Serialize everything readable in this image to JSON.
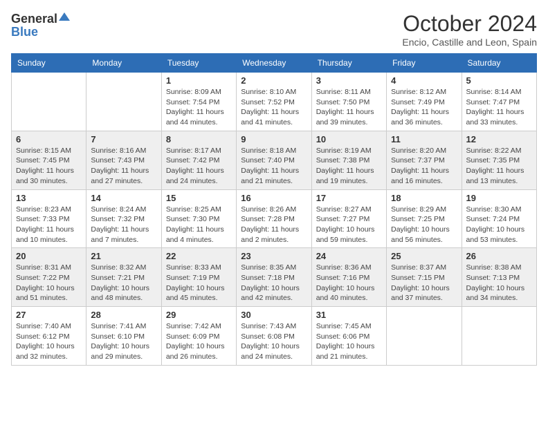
{
  "header": {
    "logo_general": "General",
    "logo_blue": "Blue",
    "month_title": "October 2024",
    "subtitle": "Encio, Castille and Leon, Spain"
  },
  "weekdays": [
    "Sunday",
    "Monday",
    "Tuesday",
    "Wednesday",
    "Thursday",
    "Friday",
    "Saturday"
  ],
  "weeks": [
    [
      {
        "day": "",
        "info": ""
      },
      {
        "day": "",
        "info": ""
      },
      {
        "day": "1",
        "info": "Sunrise: 8:09 AM\nSunset: 7:54 PM\nDaylight: 11 hours and 44 minutes."
      },
      {
        "day": "2",
        "info": "Sunrise: 8:10 AM\nSunset: 7:52 PM\nDaylight: 11 hours and 41 minutes."
      },
      {
        "day": "3",
        "info": "Sunrise: 8:11 AM\nSunset: 7:50 PM\nDaylight: 11 hours and 39 minutes."
      },
      {
        "day": "4",
        "info": "Sunrise: 8:12 AM\nSunset: 7:49 PM\nDaylight: 11 hours and 36 minutes."
      },
      {
        "day": "5",
        "info": "Sunrise: 8:14 AM\nSunset: 7:47 PM\nDaylight: 11 hours and 33 minutes."
      }
    ],
    [
      {
        "day": "6",
        "info": "Sunrise: 8:15 AM\nSunset: 7:45 PM\nDaylight: 11 hours and 30 minutes."
      },
      {
        "day": "7",
        "info": "Sunrise: 8:16 AM\nSunset: 7:43 PM\nDaylight: 11 hours and 27 minutes."
      },
      {
        "day": "8",
        "info": "Sunrise: 8:17 AM\nSunset: 7:42 PM\nDaylight: 11 hours and 24 minutes."
      },
      {
        "day": "9",
        "info": "Sunrise: 8:18 AM\nSunset: 7:40 PM\nDaylight: 11 hours and 21 minutes."
      },
      {
        "day": "10",
        "info": "Sunrise: 8:19 AM\nSunset: 7:38 PM\nDaylight: 11 hours and 19 minutes."
      },
      {
        "day": "11",
        "info": "Sunrise: 8:20 AM\nSunset: 7:37 PM\nDaylight: 11 hours and 16 minutes."
      },
      {
        "day": "12",
        "info": "Sunrise: 8:22 AM\nSunset: 7:35 PM\nDaylight: 11 hours and 13 minutes."
      }
    ],
    [
      {
        "day": "13",
        "info": "Sunrise: 8:23 AM\nSunset: 7:33 PM\nDaylight: 11 hours and 10 minutes."
      },
      {
        "day": "14",
        "info": "Sunrise: 8:24 AM\nSunset: 7:32 PM\nDaylight: 11 hours and 7 minutes."
      },
      {
        "day": "15",
        "info": "Sunrise: 8:25 AM\nSunset: 7:30 PM\nDaylight: 11 hours and 4 minutes."
      },
      {
        "day": "16",
        "info": "Sunrise: 8:26 AM\nSunset: 7:28 PM\nDaylight: 11 hours and 2 minutes."
      },
      {
        "day": "17",
        "info": "Sunrise: 8:27 AM\nSunset: 7:27 PM\nDaylight: 10 hours and 59 minutes."
      },
      {
        "day": "18",
        "info": "Sunrise: 8:29 AM\nSunset: 7:25 PM\nDaylight: 10 hours and 56 minutes."
      },
      {
        "day": "19",
        "info": "Sunrise: 8:30 AM\nSunset: 7:24 PM\nDaylight: 10 hours and 53 minutes."
      }
    ],
    [
      {
        "day": "20",
        "info": "Sunrise: 8:31 AM\nSunset: 7:22 PM\nDaylight: 10 hours and 51 minutes."
      },
      {
        "day": "21",
        "info": "Sunrise: 8:32 AM\nSunset: 7:21 PM\nDaylight: 10 hours and 48 minutes."
      },
      {
        "day": "22",
        "info": "Sunrise: 8:33 AM\nSunset: 7:19 PM\nDaylight: 10 hours and 45 minutes."
      },
      {
        "day": "23",
        "info": "Sunrise: 8:35 AM\nSunset: 7:18 PM\nDaylight: 10 hours and 42 minutes."
      },
      {
        "day": "24",
        "info": "Sunrise: 8:36 AM\nSunset: 7:16 PM\nDaylight: 10 hours and 40 minutes."
      },
      {
        "day": "25",
        "info": "Sunrise: 8:37 AM\nSunset: 7:15 PM\nDaylight: 10 hours and 37 minutes."
      },
      {
        "day": "26",
        "info": "Sunrise: 8:38 AM\nSunset: 7:13 PM\nDaylight: 10 hours and 34 minutes."
      }
    ],
    [
      {
        "day": "27",
        "info": "Sunrise: 7:40 AM\nSunset: 6:12 PM\nDaylight: 10 hours and 32 minutes."
      },
      {
        "day": "28",
        "info": "Sunrise: 7:41 AM\nSunset: 6:10 PM\nDaylight: 10 hours and 29 minutes."
      },
      {
        "day": "29",
        "info": "Sunrise: 7:42 AM\nSunset: 6:09 PM\nDaylight: 10 hours and 26 minutes."
      },
      {
        "day": "30",
        "info": "Sunrise: 7:43 AM\nSunset: 6:08 PM\nDaylight: 10 hours and 24 minutes."
      },
      {
        "day": "31",
        "info": "Sunrise: 7:45 AM\nSunset: 6:06 PM\nDaylight: 10 hours and 21 minutes."
      },
      {
        "day": "",
        "info": ""
      },
      {
        "day": "",
        "info": ""
      }
    ]
  ]
}
